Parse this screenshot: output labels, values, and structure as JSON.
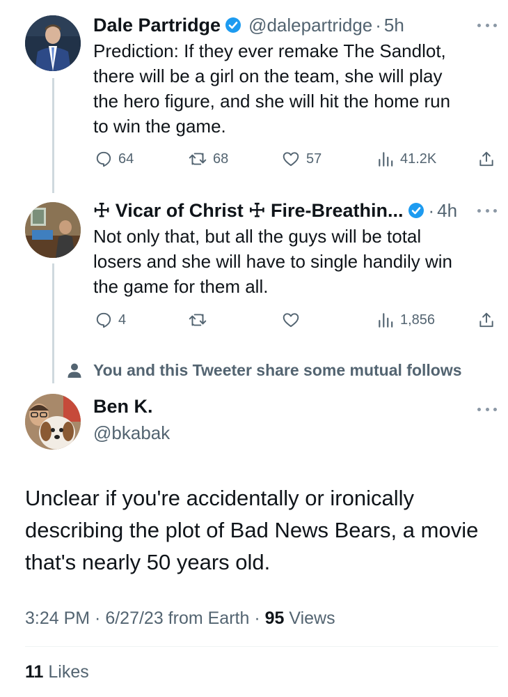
{
  "tweet1": {
    "name": "Dale Partridge",
    "handle": "@dalepartridge",
    "time": "5h",
    "lines": [
      "Prediction: If they ever remake The Sandlot,",
      "there will be a girl on the team, she will play",
      "the hero figure, and she will hit the home run",
      "to win the game."
    ],
    "replies": "64",
    "retweets": "68",
    "likes": "57",
    "views": "41.2K"
  },
  "tweet2": {
    "name": "☩ Vicar of Christ ☩ Fire-Breathin...",
    "time": "4h",
    "lines": [
      "Not only that, but all the guys will be total",
      "losers and she will have to single handily win",
      "the game for them all."
    ],
    "replies": "4",
    "views": "1,856"
  },
  "mutual_notice": "You and this Tweeter share some mutual follows",
  "main_tweet": {
    "name": "Ben K.",
    "handle": "@bkabak",
    "lines": [
      "Unclear if you're accidentally or ironically",
      "describing the plot of Bad News Bears, a movie",
      "that's nearly 50 years old."
    ],
    "timestamp": "3:24 PM · 6/27/23 from Earth · ",
    "views_count": "95",
    "views_label": " Views",
    "likes_count": "11",
    "likes_label": " Likes"
  },
  "colors": {
    "verified": "#1d9bf0",
    "muted": "#536471",
    "thread_line": "#cfd9de",
    "divider": "#eff3f4"
  }
}
